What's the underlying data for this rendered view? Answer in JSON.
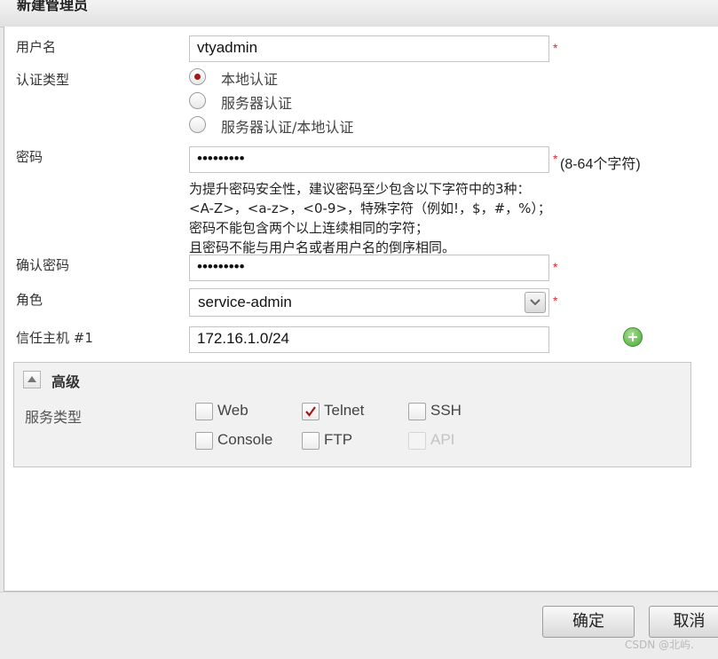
{
  "dialog": {
    "title": "新建管理员"
  },
  "form": {
    "username": {
      "label": "用户名",
      "value": "vtyadmin",
      "required_mark": "*"
    },
    "auth_type": {
      "label": "认证类型",
      "options": [
        {
          "label": "本地认证",
          "checked": true
        },
        {
          "label": "服务器认证",
          "checked": false
        },
        {
          "label": "服务器认证/本地认证",
          "checked": false
        }
      ]
    },
    "password": {
      "label": "密码",
      "value": "•••••••••",
      "required_mark": "*",
      "length_hint": "(8-64个字符)",
      "hints": [
        "为提升密码安全性，建议密码至少包含以下字符中的3种：",
        "<A-Z>，<a-z>，<0-9>，特殊字符（例如!，$，#，%）；",
        "密码不能包含两个以上连续相同的字符；",
        "且密码不能与用户名或者用户名的倒序相同。"
      ]
    },
    "confirm_password": {
      "label": "确认密码",
      "value": "•••••••••",
      "required_mark": "*"
    },
    "role": {
      "label": "角色",
      "value": "service-admin",
      "required_mark": "*"
    },
    "trusted_host": {
      "label": "信任主机 #1",
      "value": "172.16.1.0/24"
    }
  },
  "advanced": {
    "title": "高级",
    "service_type_label": "服务类型",
    "services": [
      {
        "label": "Web",
        "checked": false,
        "disabled": false
      },
      {
        "label": "Telnet",
        "checked": true,
        "disabled": false
      },
      {
        "label": "SSH",
        "checked": false,
        "disabled": false
      },
      {
        "label": "Console",
        "checked": false,
        "disabled": false
      },
      {
        "label": "FTP",
        "checked": false,
        "disabled": false
      },
      {
        "label": "API",
        "checked": false,
        "disabled": true
      }
    ]
  },
  "footer": {
    "ok_label": "确定",
    "cancel_label": "取消"
  },
  "watermark": "CSDN @北屿."
}
